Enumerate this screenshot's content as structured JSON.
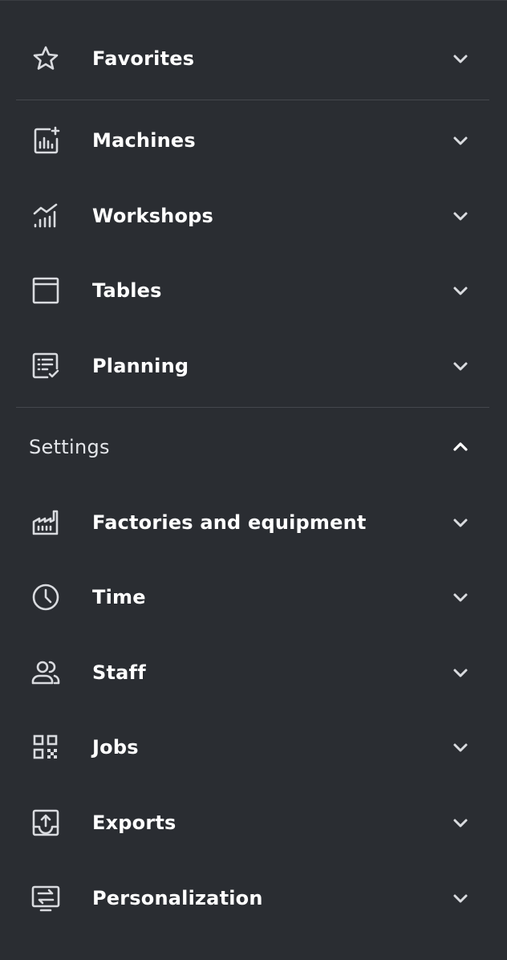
{
  "menu": {
    "items": [
      {
        "label": "Favorites",
        "icon": "star-icon"
      },
      {
        "label": "Machines",
        "icon": "machine-chart-icon"
      },
      {
        "label": "Workshops",
        "icon": "workshop-chart-icon"
      },
      {
        "label": "Tables",
        "icon": "table-icon"
      },
      {
        "label": "Planning",
        "icon": "planning-checklist-icon"
      }
    ]
  },
  "settings": {
    "label": "Settings",
    "expanded": true,
    "items": [
      {
        "label": "Factories and equipment",
        "icon": "factory-icon"
      },
      {
        "label": "Time",
        "icon": "clock-icon"
      },
      {
        "label": "Staff",
        "icon": "staff-icon"
      },
      {
        "label": "Jobs",
        "icon": "qr-grid-icon"
      },
      {
        "label": "Exports",
        "icon": "export-tray-icon"
      },
      {
        "label": "Personalization",
        "icon": "personalization-icon"
      }
    ]
  },
  "colors": {
    "background": "#2a2d32",
    "divider": "#44474d",
    "icon": "#d9dbdf",
    "text": "#ffffff"
  }
}
